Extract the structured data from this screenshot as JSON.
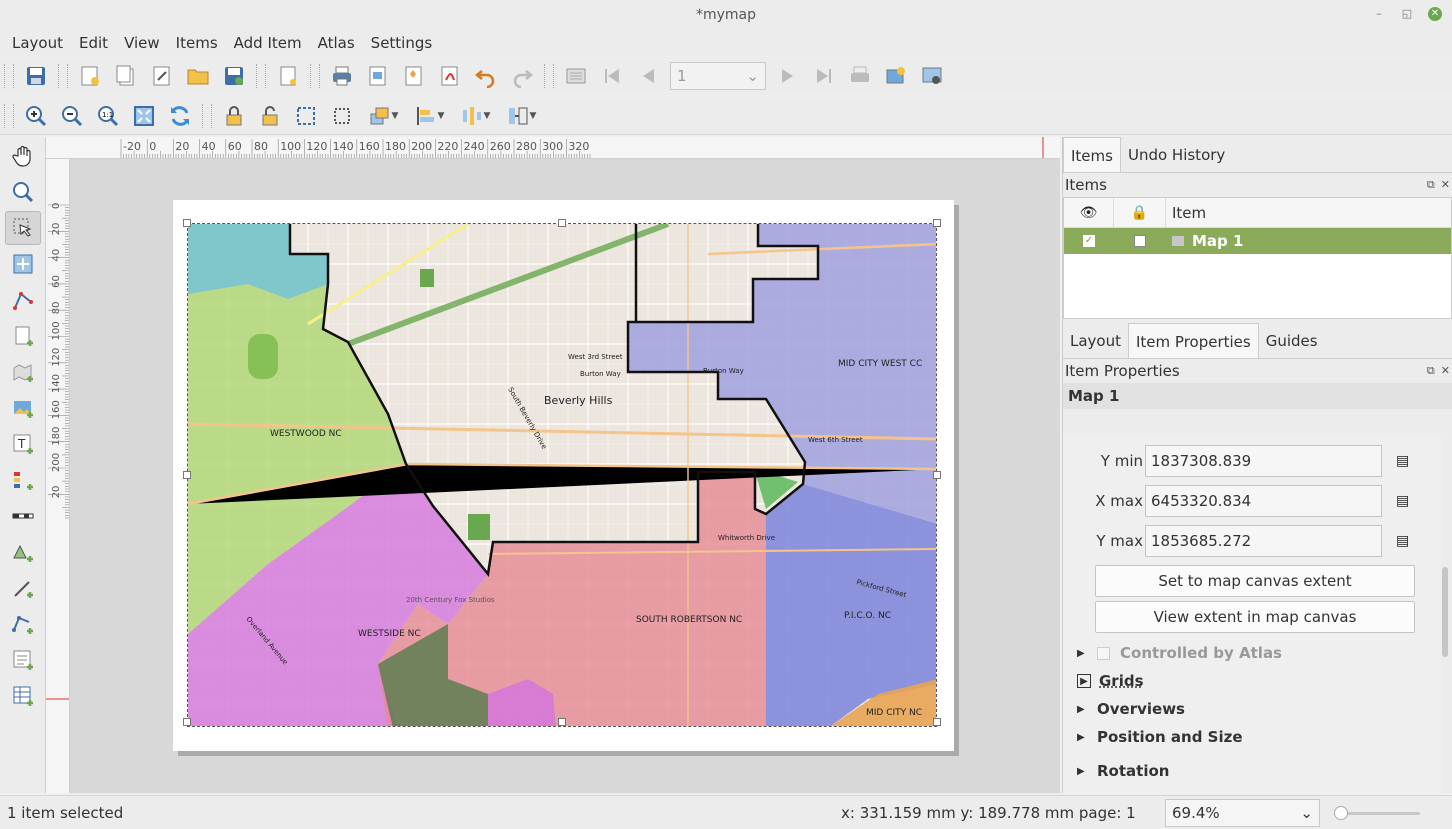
{
  "window": {
    "title": "*mymap",
    "minimize_icon": "minimize-icon",
    "maximize_icon": "restore-icon",
    "close_icon": "close-icon"
  },
  "menu": [
    "Layout",
    "Edit",
    "View",
    "Items",
    "Add Item",
    "Atlas",
    "Settings"
  ],
  "atlas_toolbar": {
    "page_value": "1"
  },
  "ruler": {
    "h_labels": [
      "-20",
      "0",
      "20",
      "40",
      "60",
      "80",
      "100",
      "120",
      "140",
      "160",
      "180",
      "200",
      "220",
      "240",
      "260",
      "280",
      "300",
      "320"
    ],
    "v_labels": [
      "0",
      "20",
      "40",
      "60",
      "80",
      "100",
      "120",
      "140",
      "160",
      "180",
      "200",
      "20"
    ]
  },
  "map_labels": {
    "beverly_hills": "Beverly Hills",
    "westwood": "WESTWOOD NC",
    "mid_city_west": "MID CITY WEST CC",
    "westside": "WESTSIDE NC",
    "south_robertson": "SOUTH ROBERTSON NC",
    "pico": "P.I.C.O. NC",
    "mid_city": "MID CITY NC",
    "west_3rd": "West 3rd Street",
    "burton_way_1": "Burton Way",
    "burton_way_2": "Burton Way",
    "west_6th": "West 6th Street",
    "whitworth": "Whitworth Drive",
    "beverly_drive": "South Beverly Drive",
    "century_fox": "20th Century Fox Studios",
    "overland": "Overland Avenue",
    "pickford": "Pickford Street"
  },
  "right_panel": {
    "tabs": [
      "Items",
      "Undo History"
    ],
    "items_title": "Items",
    "items_header": {
      "col_item": "Item"
    },
    "items_rows": [
      {
        "name": "Map 1",
        "visible": true,
        "locked": false
      }
    ],
    "prop_tabs": [
      "Layout",
      "Item Properties",
      "Guides"
    ],
    "props_title": "Item Properties",
    "item_name": "Map 1",
    "extent": [
      {
        "label": "Y min",
        "value": "1837308.839"
      },
      {
        "label": "X max",
        "value": "6453320.834"
      },
      {
        "label": "Y max",
        "value": "1853685.272"
      }
    ],
    "buttons": [
      "Set to map canvas extent",
      "View extent in map canvas"
    ],
    "controlled_by_atlas": "Controlled by Atlas",
    "sections": [
      "Grids",
      "Overviews",
      "Position and Size",
      "Rotation"
    ]
  },
  "status": {
    "selection": "1 item selected",
    "coords": "x: 331.159 mm  y: 189.778 mm  page: 1",
    "zoom": "69.4%"
  },
  "colors": {
    "accent_selected_row": "#8bab5b",
    "westwood": "#a9d56a",
    "westside": "#d575dc",
    "south_robertson": "#e68a95",
    "pico": "#7b82dc",
    "mid_city_west": "#9c9ce0",
    "mid_city": "#e8a453",
    "brentwood": "#74c3d7"
  }
}
